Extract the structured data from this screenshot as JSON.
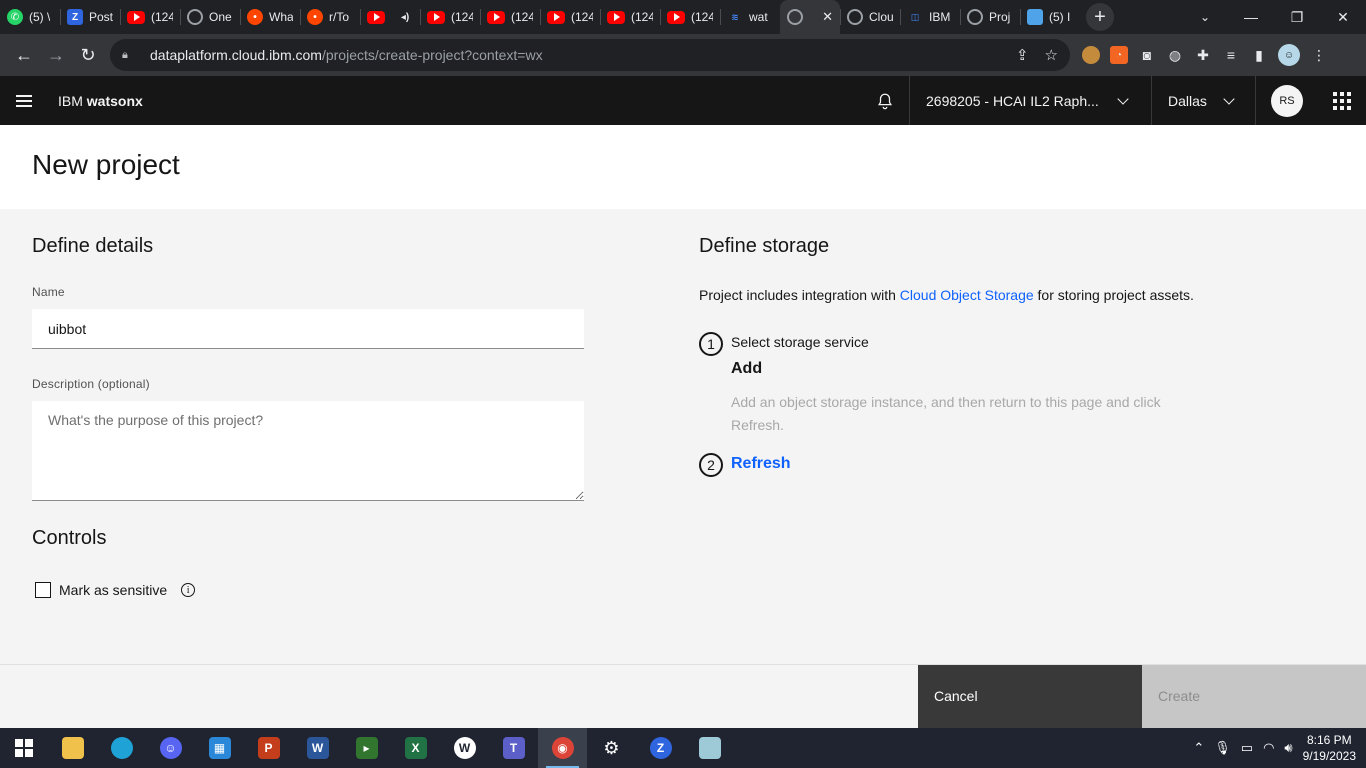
{
  "browser": {
    "tabs": [
      {
        "title": "(5) \\",
        "icon": "whatsapp-icon"
      },
      {
        "title": "Post",
        "icon": "zoho-icon"
      },
      {
        "title": "(124",
        "icon": "youtube-icon"
      },
      {
        "title": "One",
        "icon": "github-icon"
      },
      {
        "title": "Wha",
        "icon": "reddit-icon"
      },
      {
        "title": "r/To",
        "icon": "reddit-icon"
      },
      {
        "title": "(",
        "icon": "youtube-icon"
      },
      {
        "title": "(124",
        "icon": "youtube-icon"
      },
      {
        "title": "(124",
        "icon": "youtube-icon"
      },
      {
        "title": "(124",
        "icon": "youtube-icon"
      },
      {
        "title": "(124",
        "icon": "youtube-icon"
      },
      {
        "title": "(124",
        "icon": "youtube-icon"
      },
      {
        "title": "wat",
        "icon": "ibm-icon"
      },
      {
        "title": "",
        "icon": "watsonx-icon",
        "active": true
      },
      {
        "title": "Clou",
        "icon": "watsonx-icon"
      },
      {
        "title": "IBM",
        "icon": "ibm-cloud-icon"
      },
      {
        "title": "Proj",
        "icon": "watsonx-icon"
      },
      {
        "title": "(5) I",
        "icon": "cube-icon"
      }
    ],
    "url_host": "dataplatform.cloud.ibm.com",
    "url_path": "/projects/create-project?context=wx"
  },
  "header": {
    "brand_prefix": "IBM ",
    "brand_name": "watsonx",
    "account": "2698205 - HCAI IL2 Raph...",
    "region": "Dallas",
    "avatar_initials": "RS"
  },
  "page": {
    "title": "New project"
  },
  "details": {
    "heading": "Define details",
    "name_label": "Name",
    "name_value": "uibbot",
    "description_label": "Description (optional)",
    "description_placeholder": "What's the purpose of this project?",
    "controls_heading": "Controls",
    "sensitive_label": "Mark as sensitive",
    "sensitive_checked": false
  },
  "storage": {
    "heading": "Define storage",
    "desc_before": "Project includes integration with ",
    "desc_link": "Cloud Object Storage",
    "desc_after": " for storing project assets.",
    "step1_number": "1",
    "step1_label": "Select storage service",
    "add_label": "Add",
    "add_help": "Add an object storage instance, and then return to this page and click Refresh.",
    "step2_number": "2",
    "refresh_label": "Refresh"
  },
  "footer": {
    "cancel_label": "Cancel",
    "create_label": "Create"
  },
  "taskbar": {
    "apps": [
      "file-explorer",
      "edge",
      "discord",
      "store",
      "powerpoint",
      "word",
      "planner",
      "excel",
      "webex",
      "teams",
      "chrome",
      "settings",
      "zoho",
      "notes"
    ],
    "time": "8:16 PM",
    "date": "9/19/2023"
  },
  "colors": {
    "accent": "#0f62fe",
    "header_bg": "#161616",
    "cancel_bg": "#393939",
    "create_disabled_bg": "#c6c6c6"
  }
}
